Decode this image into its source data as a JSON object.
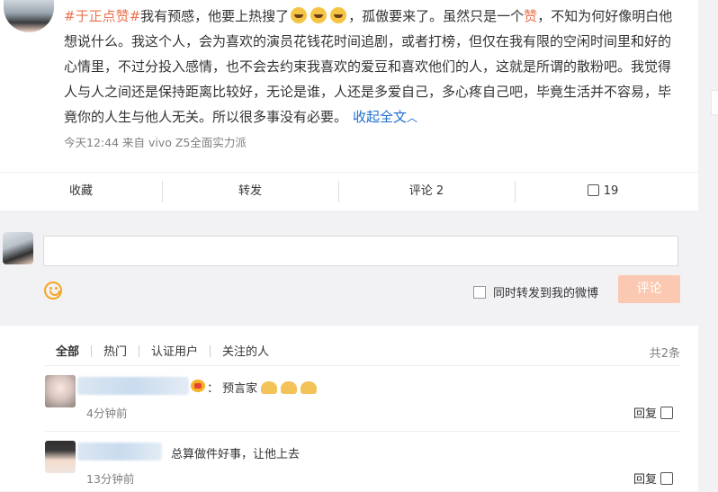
{
  "post": {
    "topic": "#于正点赞#",
    "text_part1": "我有预感，他要上热搜了",
    "emoji_name": "laugh-emoji",
    "text_part2": "，孤傲要来了。虽然只是一个",
    "highlight": "赞",
    "text_part3": "，不知为何好像明白他想说什么。我这个人，会为喜欢的演员花钱花时间追剧，或者打榜，但仅在我有限的空闲时间里和好的心情里，不过分投入感情，也不会去约束我喜欢的爱豆和喜欢他们的人，这就是所谓的散粉吧。我觉得人与人之间还是保持距离比较好，无论是谁，人还是多爱自己，多心疼自己吧，毕竟生活并不容易，毕竟你的人生与他人无关。所以很多事没有必要。",
    "collapse_label": "收起全文",
    "meta": "今天12:44  来自 vivo Z5全面实力派"
  },
  "actions": {
    "favorite": "收藏",
    "repost": "转发",
    "comment": "评论 2",
    "likes": "19"
  },
  "composer": {
    "input_value": "",
    "repost_checkbox_label": "同时转发到我的微博",
    "repost_checked": false,
    "submit_label": "评论"
  },
  "comments": {
    "tabs": [
      "全部",
      "热门",
      "认证用户",
      "关注的人"
    ],
    "active_tab": "全部",
    "count_label": "共2条",
    "items": [
      {
        "text": "：  预言家",
        "time": "4分钟前",
        "reply_label": "回复"
      },
      {
        "text": "总算做件好事，让他上去",
        "time": "13分钟前",
        "reply_label": "回复"
      }
    ]
  },
  "colors": {
    "topic": "#eb7350",
    "link": "#1e6fd0",
    "submit_bg": "#fbc9b1"
  }
}
